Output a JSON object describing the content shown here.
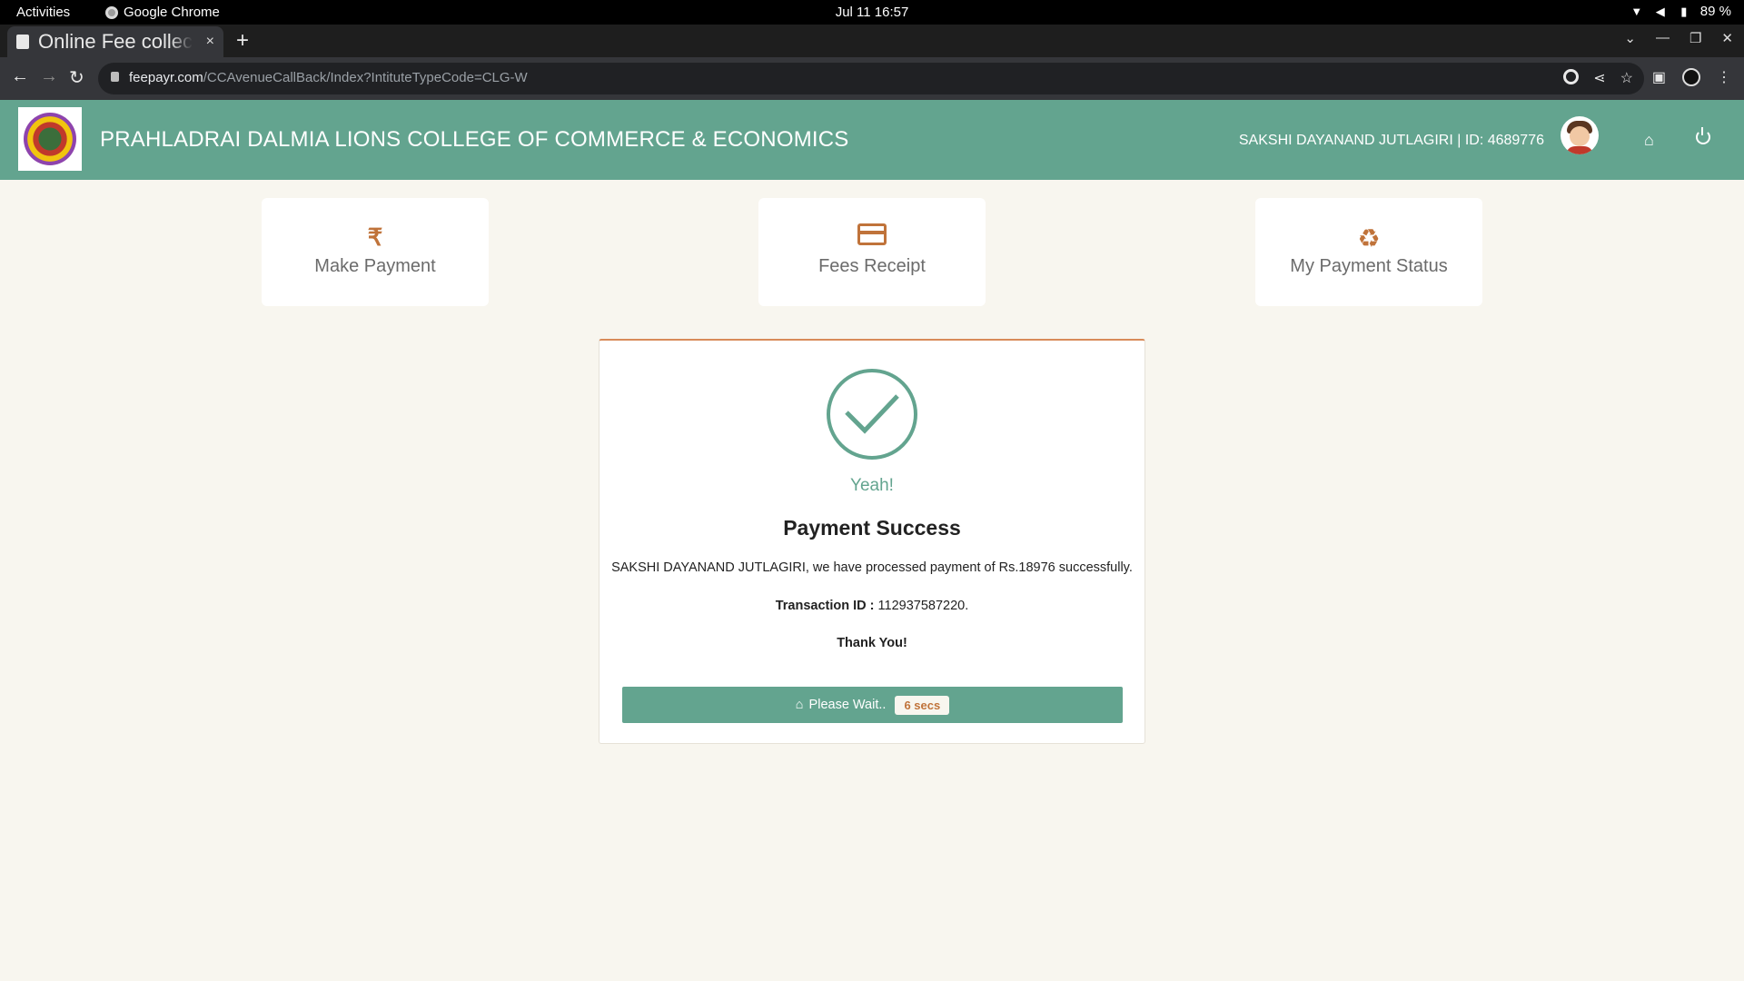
{
  "os_bar": {
    "activities": "Activities",
    "app_name": "Google Chrome",
    "clock": "Jul 11  16:57",
    "battery": "89 %"
  },
  "browser": {
    "tab_title": "Online Fee collection",
    "tab_close": "×",
    "new_tab": "+",
    "url_host": "feepayr.com",
    "url_path": "/CCAvenueCallBack/Index?IntituteTypeCode=CLG-W"
  },
  "header": {
    "college_name": "PRAHLADRAI DALMIA LIONS COLLEGE OF COMMERCE & ECONOMICS",
    "user_info": "SAKSHI DAYANAND JUTLAGIRI | ID: 4689776",
    "brand_color": "#63a48f"
  },
  "nav_cards": [
    {
      "label": "Make Payment",
      "icon": "rupee-icon"
    },
    {
      "label": "Fees Receipt",
      "icon": "credit-card-icon"
    },
    {
      "label": "My Payment Status",
      "icon": "recycle-icon"
    }
  ],
  "result": {
    "exclaim": "Yeah!",
    "title": "Payment Success",
    "message": "SAKSHI DAYANAND JUTLAGIRI, we have processed payment of Rs.18976 successfully.",
    "txn_label": "Transaction ID :",
    "txn_value": " 112937587220.",
    "thanks": "Thank You!",
    "wait_label": "Please Wait..",
    "countdown": "6 secs",
    "accent_color": "#d88b59"
  }
}
